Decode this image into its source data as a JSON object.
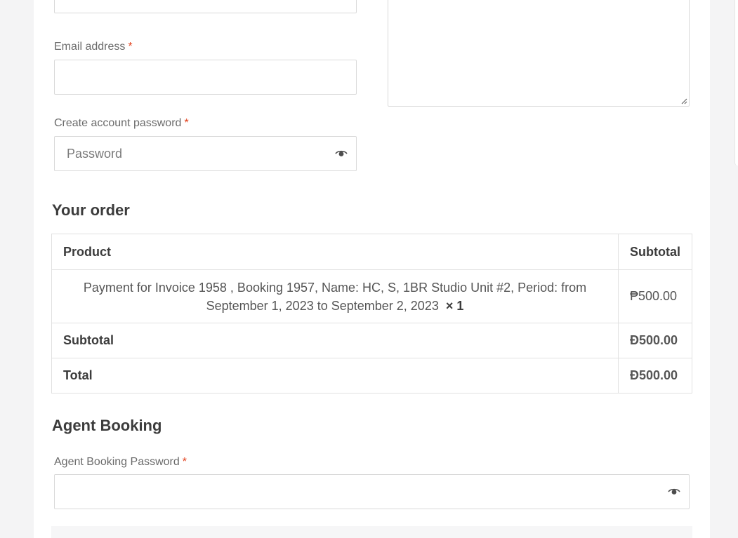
{
  "billing": {
    "email_label": "Email address",
    "email_required": "*",
    "email_value": "",
    "password_label": "Create account password",
    "password_required": "*",
    "password_placeholder": "Password"
  },
  "order": {
    "heading": "Your order",
    "col_product": "Product",
    "col_subtotal": "Subtotal",
    "item": {
      "description": "Payment for Invoice 1958 , Booking 1957, Name: HC, S, 1BR Studio Unit #2, Period: from September 1, 2023 to September 2, 2023",
      "quantity": "× 1",
      "price": "₱500.00"
    },
    "subtotal_label": "Subtotal",
    "subtotal_value": "Ð500.00",
    "total_label": "Total",
    "total_value": "Ð500.00"
  },
  "agent": {
    "heading": "Agent Booking",
    "password_label": "Agent Booking Password",
    "password_required": "*",
    "password_value": ""
  },
  "icons": {
    "show_password": "eye-icon",
    "resize": "resize-grip-icon"
  },
  "colors": {
    "required": "#e2401c",
    "border": "#d9d9d9",
    "text": "#3c3c3c"
  }
}
